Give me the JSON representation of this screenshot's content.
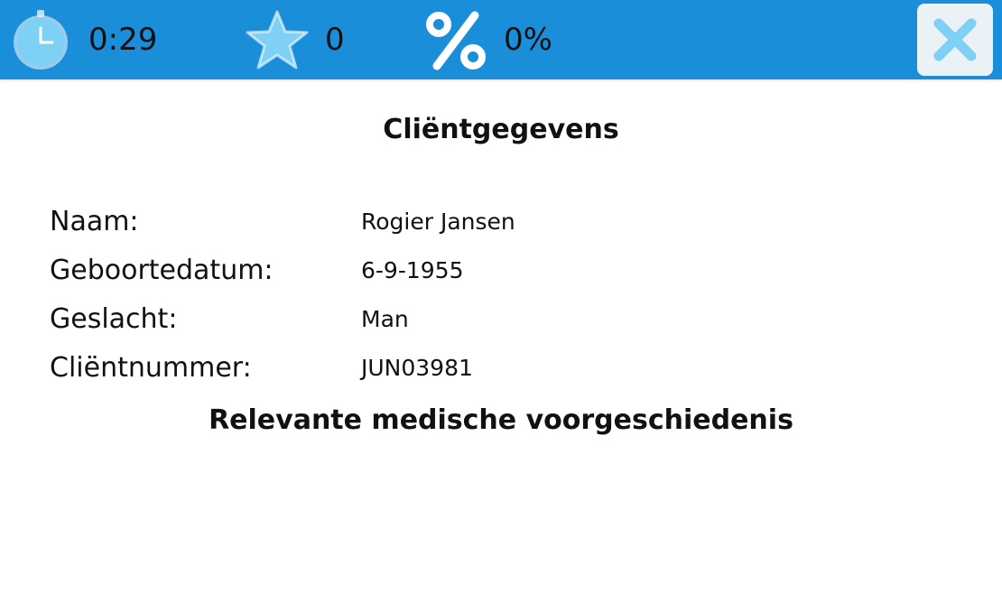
{
  "header": {
    "timer": {
      "icon": "stopwatch-icon",
      "value": "0:29"
    },
    "stars": {
      "icon": "star-icon",
      "value": "0"
    },
    "score": {
      "icon": "percent-icon",
      "value": "0%"
    },
    "close": {
      "icon": "close-icon"
    },
    "colors": {
      "bar": "#1a8ed9",
      "icon_light": "#7fd0f5",
      "close_bg": "#eaf2f6"
    }
  },
  "client": {
    "title": "Cliëntgegevens",
    "rows": [
      {
        "label": "Naam:",
        "value": "Rogier Jansen"
      },
      {
        "label": "Geboortedatum:",
        "value": "6-9-1955"
      },
      {
        "label": "Geslacht:",
        "value": "Man"
      },
      {
        "label": "Cliëntnummer:",
        "value": "JUN03981"
      }
    ]
  },
  "history": {
    "title": "Relevante medische voorgeschiedenis"
  }
}
